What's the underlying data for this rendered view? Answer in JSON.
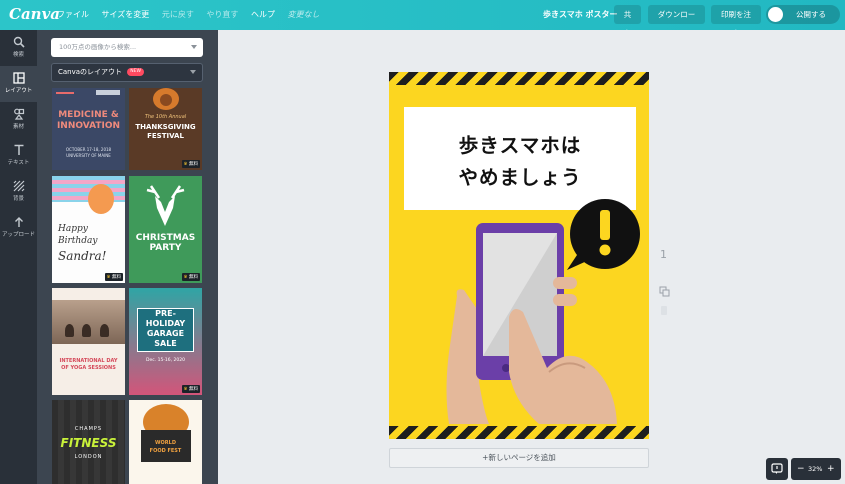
{
  "app": {
    "logo": "Canva"
  },
  "menu": {
    "file": "ファイル",
    "resize": "サイズを変更",
    "undo": "元に戻す",
    "redo": "やり直す",
    "help": "ヘルプ",
    "status": "変更なし"
  },
  "header": {
    "doc_title": "歩きスマホ ポスター",
    "share": "共有",
    "download": "ダウンロード",
    "print": "印刷を注文",
    "publish": "公開する"
  },
  "rail": [
    {
      "label": "検索",
      "icon": "search-icon"
    },
    {
      "label": "レイアウト",
      "icon": "layout-icon"
    },
    {
      "label": "素材",
      "icon": "elements-icon"
    },
    {
      "label": "テキスト",
      "icon": "text-icon"
    },
    {
      "label": "背景",
      "icon": "background-icon"
    },
    {
      "label": "アップロード",
      "icon": "upload-icon"
    }
  ],
  "panel": {
    "search_placeholder": "100万点の画像から検索...",
    "layout_select": "Canvaのレイアウト",
    "new_badge": "NEW",
    "free_label": "無料",
    "thumbs": [
      {
        "l1": "MEDICINE &",
        "l2": "INNOVATION",
        "l3": "OCTOBER 17-18, 2018",
        "l4": "UNIVERSITY OF MAINE"
      },
      {
        "l1": "The 10th Annual",
        "l2": "THANKSGIVING",
        "l3": "FESTIVAL"
      },
      {
        "l1": "Happy",
        "l2": "Birthday",
        "l3": "Sandra!"
      },
      {
        "l1": "CHRISTMAS",
        "l2": "PARTY"
      },
      {
        "l1": "INTERNATIONAL DAY",
        "l2": "OF YOGA SESSIONS"
      },
      {
        "l1": "PRE-",
        "l2": "HOLIDAY",
        "l3": "GARAGE",
        "l4": "SALE",
        "l5": "Dec. 15-16, 2020"
      },
      {
        "l1": "CHAMPS",
        "l2": "FITNESS",
        "l3": "LONDON"
      },
      {
        "l1": "WORLD",
        "l2": "FOOD FEST"
      }
    ]
  },
  "poster": {
    "line1": "歩きスマホは",
    "line2": "やめましょう"
  },
  "canvas": {
    "page_number": "1",
    "add_page": "+新しいページを追加",
    "zoom": "32%",
    "zoom_minus": "−",
    "zoom_plus": "+"
  },
  "colors": {
    "topbar": "#2cc5c9",
    "poster_bg": "#fcd620",
    "phone": "#6b3fa8",
    "hand": "#e4b89a"
  }
}
